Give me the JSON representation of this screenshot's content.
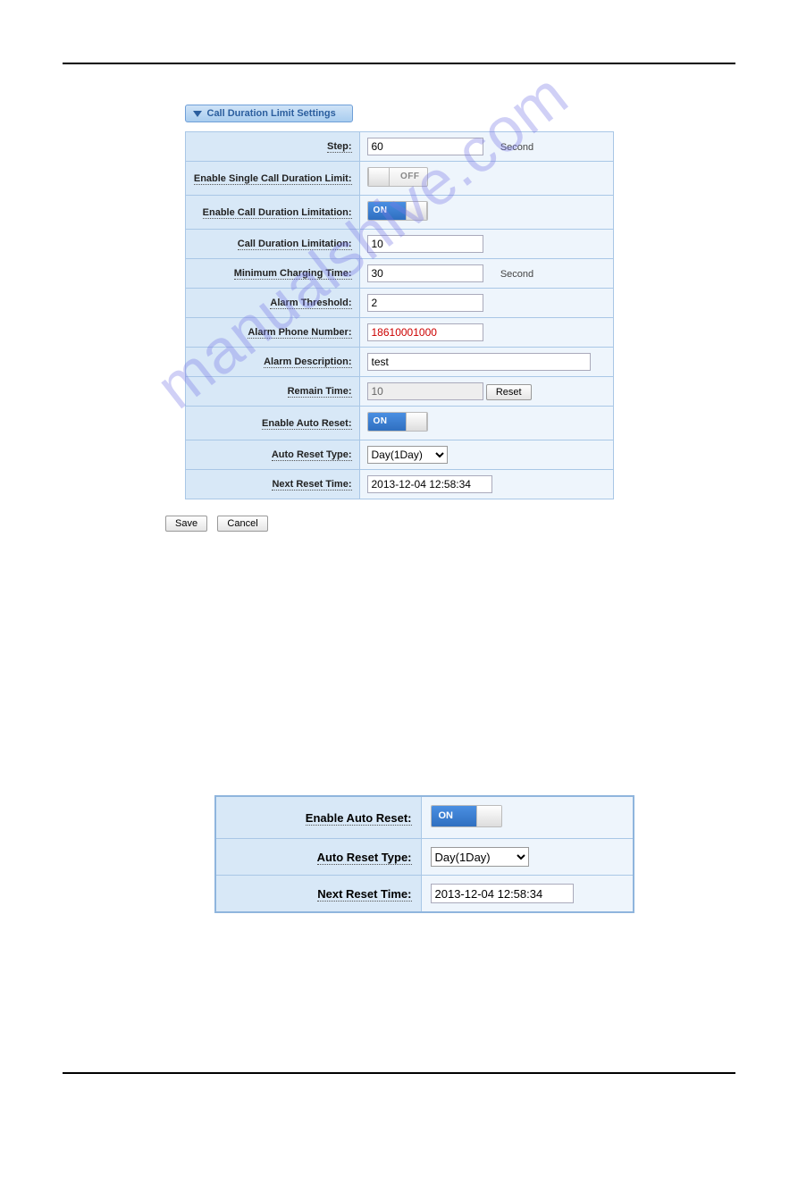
{
  "panel": {
    "title": "Call Duration Limit Settings",
    "rows": {
      "step": {
        "label": "Step:",
        "value": "60",
        "unit": "Second"
      },
      "single_limit": {
        "label": "Enable Single Call Duration Limit:",
        "state": "OFF"
      },
      "enable_limit": {
        "label": "Enable Call Duration Limitation:",
        "state": "ON"
      },
      "duration_limit": {
        "label": "Call Duration Limitation:",
        "value": "10"
      },
      "min_charge": {
        "label": "Minimum Charging Time:",
        "value": "30",
        "unit": "Second"
      },
      "alarm_thresh": {
        "label": "Alarm Threshold:",
        "value": "2"
      },
      "alarm_phone": {
        "label": "Alarm Phone Number:",
        "value": "18610001000"
      },
      "alarm_desc": {
        "label": "Alarm Description:",
        "value": "test"
      },
      "remain": {
        "label": "Remain Time:",
        "value": "10",
        "reset": "Reset"
      },
      "enable_auto": {
        "label": "Enable Auto Reset:",
        "state": "ON"
      },
      "auto_type": {
        "label": "Auto Reset Type:",
        "value": "Day(1Day)"
      },
      "next_reset": {
        "label": "Next Reset Time:",
        "value": "2013-12-04 12:58:34"
      }
    }
  },
  "buttons": {
    "save": "Save",
    "cancel": "Cancel"
  },
  "panel2": {
    "enable_auto": {
      "label": "Enable Auto Reset:",
      "state": "ON"
    },
    "auto_type": {
      "label": "Auto Reset Type:",
      "value": "Day(1Day)"
    },
    "next_reset": {
      "label": "Next Reset Time:",
      "value": "2013-12-04 12:58:34"
    }
  },
  "watermark": "manualshive.com"
}
